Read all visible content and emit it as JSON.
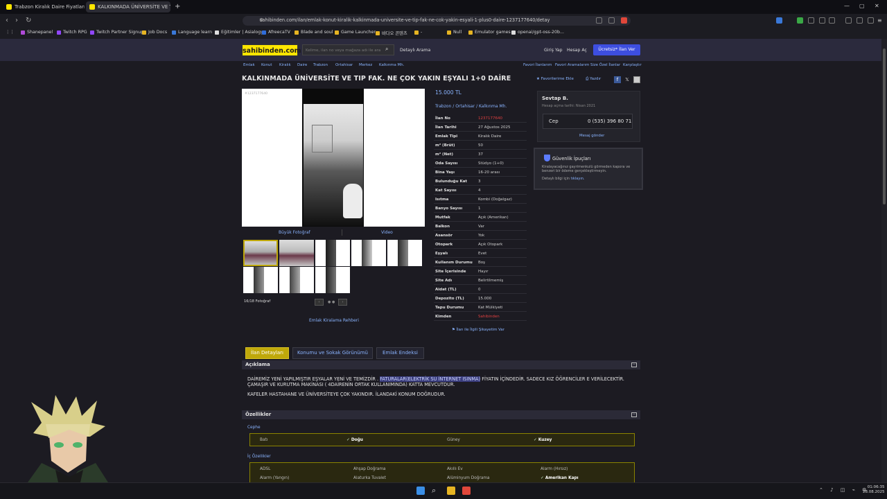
{
  "browser": {
    "tabs": [
      {
        "title": "Trabzon Kiralık Daire Fiyatları ve Kir",
        "active": false
      },
      {
        "title": "KALKINMADA ÜNİVERSİTE VE TIP FA",
        "active": true
      }
    ],
    "new_tab": "+",
    "url": "sahibinden.com/ilan/emlak-konut-kiralik-kalkinmada-universite-ve-tip-fak-ne-cok-yakin-esyali-1-plus0-daire-1237177640/detay",
    "bookmarks": [
      "Shanepanel",
      "Twitch RPG",
      "Twitch Partner Signup",
      "Job Docs",
      "Language learn",
      "Eğitimler | Asialogy",
      "AfreecaTV",
      "Blade and soul",
      "Game Launcher",
      "바다오 콘텐츠",
      "-",
      "Null",
      "Emulator games",
      "openai/gpt-oss-20b..."
    ],
    "window_controls": [
      "—",
      "▢",
      "✕"
    ]
  },
  "site": {
    "logo": "sahibinden.com",
    "search_placeholder": "Kelime, ilan no veya mağaza adı ile ara",
    "detailed_search": "Detaylı Arama",
    "login": "Giriş Yap",
    "signup": "Hesap Aç",
    "post_ad": "Ücretsiz* İlan Ver"
  },
  "breadcrumbs": [
    "Emlak",
    "Konut",
    "Kiralık",
    "Daire",
    "Trabzon",
    "Ortahisar",
    "Merkez",
    "Kalkınma Mh."
  ],
  "top_links": [
    "Favori İlanlarım",
    "Favori Aramalarım",
    "Size Özel İlanlar",
    "Karşılaştır"
  ],
  "listing": {
    "title": "KALKINMADA ÜNİVERSİTE VE TIP FAK. NE ÇOK YAKIN EŞYALI 1+0 DAİRE",
    "fav_add": "Favorilerime Ekle",
    "print": "Yazdır",
    "photo_id": "#1237177640",
    "big_photo": "Büyük Fotoğraf",
    "video": "Video",
    "photo_count": "16/18 Fotoğraf",
    "rental_guide": "Emlak Kiralama Rehberi",
    "price": "15.000 TL",
    "location": [
      "Trabzon",
      "Ortahisar",
      "Kalkınma Mh."
    ],
    "complain": "İlan ile İlgili Şikayetim Var",
    "info": [
      {
        "k": "İlan No",
        "v": "1237177640",
        "red": true
      },
      {
        "k": "İlan Tarihi",
        "v": "27 Ağustos 2025"
      },
      {
        "k": "Emlak Tipi",
        "v": "Kiralık Daire"
      },
      {
        "k": "m² (Brüt)",
        "v": "50"
      },
      {
        "k": "m² (Net)",
        "v": "37"
      },
      {
        "k": "Oda Sayısı",
        "v": "Stüdyo (1+0)"
      },
      {
        "k": "Bina Yaşı",
        "v": "16-20 arası"
      },
      {
        "k": "Bulunduğu Kat",
        "v": "3"
      },
      {
        "k": "Kat Sayısı",
        "v": "4"
      },
      {
        "k": "Isıtma",
        "v": "Kombi (Doğalgaz)"
      },
      {
        "k": "Banyo Sayısı",
        "v": "1"
      },
      {
        "k": "Mutfak",
        "v": "Açık (Amerikan)"
      },
      {
        "k": "Balkon",
        "v": "Var"
      },
      {
        "k": "Asansör",
        "v": "Yok"
      },
      {
        "k": "Otopark",
        "v": "Açık Otopark"
      },
      {
        "k": "Eşyalı",
        "v": "Evet"
      },
      {
        "k": "Kullanım Durumu",
        "v": "Boş"
      },
      {
        "k": "Site İçerisinde",
        "v": "Hayır"
      },
      {
        "k": "Site Adı",
        "v": "Belirtilmemiş"
      },
      {
        "k": "Aidat (TL)",
        "v": "0"
      },
      {
        "k": "Depozito (TL)",
        "v": "15.000"
      },
      {
        "k": "Tapu Durumu",
        "v": "Kat Mülkiyeti"
      },
      {
        "k": "Kimden",
        "v": "Sahibinden",
        "red": true
      }
    ]
  },
  "seller": {
    "name": "Sevtap B.",
    "since": "Hesap açma tarihi: Nisan 2021",
    "phone_label": "Cep",
    "phone": "0 (535) 396 80 71",
    "message": "Mesaj gönder"
  },
  "safety": {
    "title": "Güvenlik İpuçları",
    "text": "Kiralayacağınız gayrimenkulü görmeden kapora ve benzeri bir ödeme gerçekleştirmeyin.",
    "more": "Detaylı bilgi için",
    "more_link": "tıklayın."
  },
  "detail_tabs": [
    "İlan Detayları",
    "Konumu ve Sokak Görünümü",
    "Emlak Endeksi"
  ],
  "description": {
    "header": "Açıklama",
    "p1_before": "DAİREMİZ YENİ YAPILMIŞTIR EŞYALAR YENİ VE TEMİZDİR . ",
    "p1_hl": "FATURALAR(ELEKTRİK SU İNTERNET ISINMA)",
    "p1_after": " FİYATIN İÇİNDEDİR. SADECE KIZ ÖĞRENCİLER E VERİLECEKTİR. ÇAMAŞIR VE KURUTMA MAKİNASI ( 4DAİRENİN ORTAK KULLANIMINDA) KATTA MEVCUTDUR.",
    "p2": "KAFELER HASTAHANE VE ÜNİVERSİTEYE ÇOK YAKINDIR. İLANDAKİ KONUM DOĞRUDUR."
  },
  "features": {
    "header": "Özellikler",
    "cephe_title": "Cephe",
    "cephe": [
      {
        "label": "Batı",
        "on": false
      },
      {
        "label": "Doğu",
        "on": true
      },
      {
        "label": "Güney",
        "on": false
      },
      {
        "label": "Kuzey",
        "on": true
      }
    ],
    "ic_title": "İç Özellikler",
    "ic": [
      {
        "label": "ADSL",
        "on": false
      },
      {
        "label": "Ahşap Doğrama",
        "on": false
      },
      {
        "label": "Akıllı Ev",
        "on": false
      },
      {
        "label": "Alarm (Hırsız)",
        "on": false
      },
      {
        "label": "Alarm (Yangın)",
        "on": false
      },
      {
        "label": "Alaturka Tuvalet",
        "on": false
      },
      {
        "label": "Alüminyum Doğrama",
        "on": false
      },
      {
        "label": "Amerikan Kapı",
        "on": true
      }
    ]
  },
  "taskbar": {
    "time": "01:06:35",
    "date": "28.08.2025"
  },
  "colors": {
    "accent": "#8ab4ff",
    "logo": "#ffe600",
    "active_tab": "#bfa80a",
    "danger": "#e04040"
  }
}
